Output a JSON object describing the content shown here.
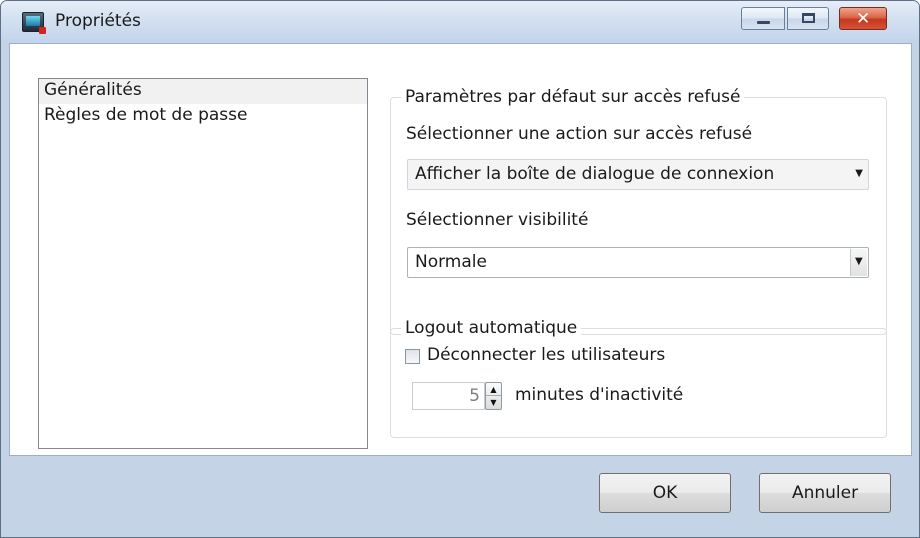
{
  "window": {
    "title": "Propriétés",
    "controls": {
      "minimize_icon": "minimize-icon",
      "maximize_icon": "maximize-icon",
      "close_icon": "close-icon",
      "close_glyph": "✕"
    }
  },
  "nav": {
    "items": [
      {
        "label": "Généralités",
        "selected": true
      },
      {
        "label": "Règles de mot de passe",
        "selected": false
      }
    ]
  },
  "access_denied": {
    "group_title": "Paramètres par défaut sur accès refusé",
    "action_label": "Sélectionner une action sur accès refusé",
    "action_value": "Afficher la boîte de dialogue de connexion",
    "visibility_label": "Sélectionner visibilité",
    "visibility_value": "Normale"
  },
  "auto_logout": {
    "group_title": "Logout automatique",
    "checkbox_label": "Déconnecter les utilisateurs",
    "checked": false,
    "minutes_value": "5",
    "minutes_label": "minutes d'inactivité"
  },
  "footer": {
    "ok_label": "OK",
    "cancel_label": "Annuler"
  },
  "glyphs": {
    "dropdown": "▼",
    "up": "▲",
    "down": "▼"
  }
}
